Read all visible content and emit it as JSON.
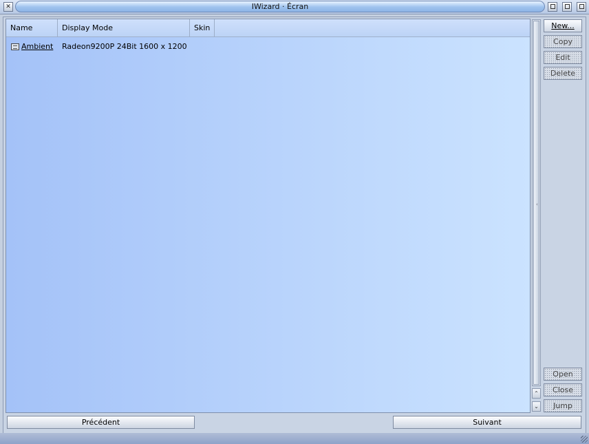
{
  "window": {
    "title": "IWizard · Écran"
  },
  "list": {
    "columns": [
      "Name",
      "Display Mode",
      "Skin"
    ],
    "rows": [
      {
        "name": "Ambient",
        "display_mode": "Radeon9200P 24Bit 1600 x 1200",
        "skin": ""
      }
    ]
  },
  "side_buttons": [
    {
      "label": "New...",
      "enabled": true
    },
    {
      "label": "Copy",
      "enabled": false
    },
    {
      "label": "Edit",
      "enabled": false
    },
    {
      "label": "Delete",
      "enabled": false
    },
    {
      "label": "Open",
      "enabled": false
    },
    {
      "label": "Close",
      "enabled": false
    },
    {
      "label": "Jump",
      "enabled": false
    }
  ],
  "bottom_buttons": {
    "previous": "Précédent",
    "next": "Suivant"
  }
}
